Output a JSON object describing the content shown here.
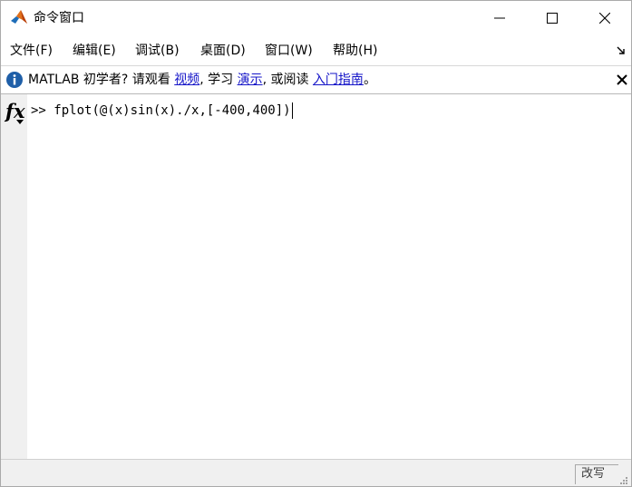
{
  "window": {
    "title": "命令窗口"
  },
  "menu": {
    "items": [
      {
        "label": "文件(F)"
      },
      {
        "label": "编辑(E)"
      },
      {
        "label": "调试(B)"
      },
      {
        "label": "桌面(D)"
      },
      {
        "label": "窗口(W)"
      },
      {
        "label": "帮助(H)"
      }
    ]
  },
  "infobar": {
    "prefix": "MATLAB 初学者? 请观看 ",
    "link_video": "视频",
    "mid1": ", 学习 ",
    "link_demo": "演示",
    "mid2": ", 或阅读 ",
    "link_guide": "入门指南",
    "suffix": "。"
  },
  "command": {
    "prompt": ">> ",
    "input": "fplot(@(x)sin(x)./x,[-400,400])"
  },
  "status": {
    "mode": "改写"
  },
  "icons": {
    "app": "matlab-logo-icon",
    "info": "info-icon",
    "fx": "function-browser-icon"
  },
  "colors": {
    "link": "#1515c8",
    "info_icon": "#1f5fa8",
    "logo_orange": "#e0701b",
    "logo_blue": "#1e6db8"
  }
}
